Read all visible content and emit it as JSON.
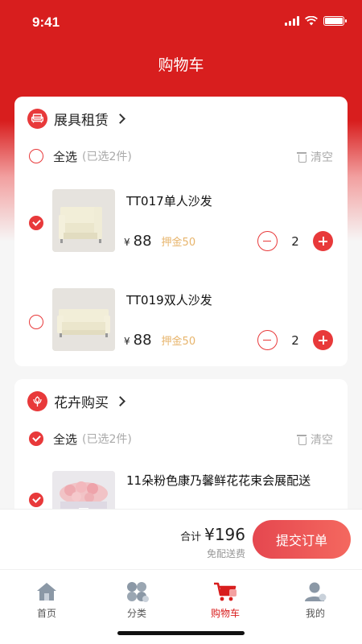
{
  "status_bar": {
    "time": "9:41"
  },
  "header": {
    "title": "购物车"
  },
  "stores": [
    {
      "name": "展具租赁",
      "select_all_label": "全选",
      "selected_count": "(已选2件)",
      "clear_label": "清空",
      "select_all_checked": false,
      "items": [
        {
          "name": "TT017单人沙发",
          "currency": "¥",
          "price": "88",
          "deposit": "押金50",
          "quantity": "2",
          "checked": true,
          "image": "sofa-single"
        },
        {
          "name": "TT019双人沙发",
          "currency": "¥",
          "price": "88",
          "deposit": "押金50",
          "quantity": "2",
          "checked": false,
          "image": "sofa-double"
        }
      ]
    },
    {
      "name": "花卉购买",
      "select_all_label": "全选",
      "selected_count": "(已选2件)",
      "clear_label": "清空",
      "select_all_checked": true,
      "items": [
        {
          "name": "11朵粉色康乃馨鲜花花束会展配送",
          "checked": true,
          "image": "flower-bouquet"
        }
      ]
    }
  ],
  "checkout": {
    "total_label": "合计",
    "total_value": "¥196",
    "shipping_note": "免配送费",
    "submit_label": "提交订单"
  },
  "tab_bar": {
    "items": [
      {
        "label": "首页",
        "icon": "home-icon",
        "active": false
      },
      {
        "label": "分类",
        "icon": "category-icon",
        "active": false
      },
      {
        "label": "购物车",
        "icon": "cart-icon",
        "active": true
      },
      {
        "label": "我的",
        "icon": "profile-icon",
        "active": false
      }
    ]
  },
  "colors": {
    "brand": "#d81e1e",
    "accent": "#e8393a",
    "deposit": "#e7b46b"
  }
}
